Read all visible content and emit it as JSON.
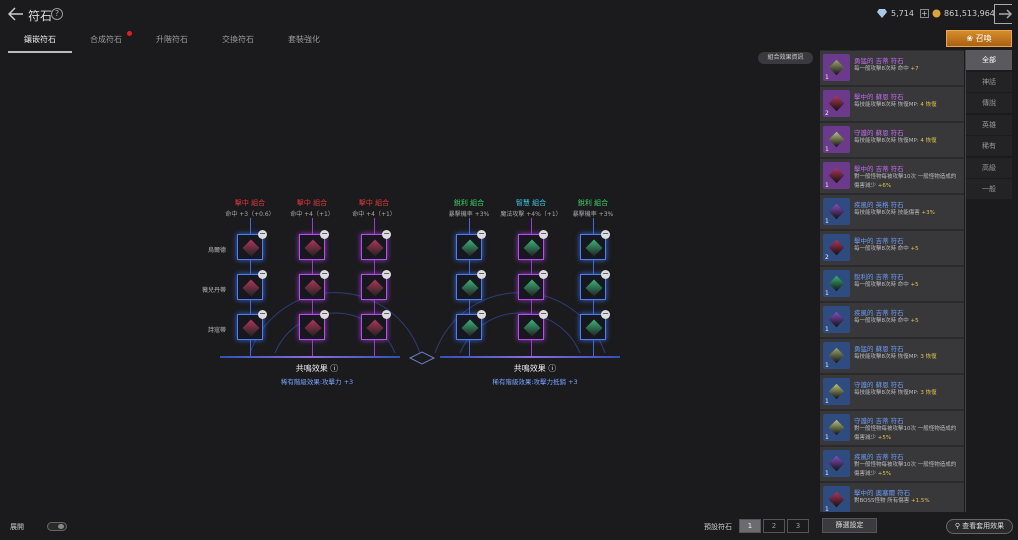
{
  "header": {
    "title": "符石",
    "help": "?",
    "diamonds": "5,714",
    "gold": "861,513,964"
  },
  "tabs": [
    {
      "label": "鑲嵌符石",
      "active": true
    },
    {
      "label": "合成符石",
      "badge": true
    },
    {
      "label": "升階符石"
    },
    {
      "label": "交換符石"
    },
    {
      "label": "套裝強化"
    }
  ],
  "summon_label": "召喚",
  "combo_info_label": "組合效果資訊",
  "board": {
    "row_labels": [
      "烏爾德",
      "薇兒丹蒂",
      "詩寇蒂"
    ],
    "left_combos": [
      {
        "name": "擊中 組合",
        "effect": "命中 +3（+0.6）",
        "color": "#e03a3a"
      },
      {
        "name": "擊中 組合",
        "effect": "命中 +4（+1）",
        "color": "#e03a3a"
      },
      {
        "name": "擊中 組合",
        "effect": "命中 +4（+1）",
        "color": "#e03a3a"
      }
    ],
    "right_combos": [
      {
        "name": "銳利 組合",
        "effect": "暴擊機率 +3%",
        "color": "#3ed46a"
      },
      {
        "name": "智慧 組合",
        "effect": "魔法攻擊 +4%（+1）",
        "color": "#3ec9e8"
      },
      {
        "name": "銳利 組合",
        "effect": "暴擊機率 +3%",
        "color": "#3ed46a"
      }
    ],
    "left_resonance": {
      "title": "共鳴效果 ⓘ",
      "effect": "稀有階級效果:攻擊力 +3"
    },
    "right_resonance": {
      "title": "共鳴效果 ⓘ",
      "effect": "稀有階級效果:攻擊力抵銷 +3"
    }
  },
  "rune_list": [
    {
      "name": "勇猛的 吉蒂 符石",
      "desc": "每一般攻擊8次時 命中",
      "bonus": "+7",
      "count": "1",
      "bg": "#6c3a8c",
      "gem": "#9fa86c"
    },
    {
      "name": "擊中的 蘇恩 符石",
      "desc": "每技能攻擊8次時 恢復MP:",
      "bonus": "4 恢復",
      "count": "2",
      "bg": "#6c3a8c",
      "gem": "#b0365a"
    },
    {
      "name": "守護的 蘇恩 符石",
      "desc": "每技能攻擊8次時 恢復MP:",
      "bonus": "4 恢復",
      "count": "1",
      "bg": "#6c3a8c",
      "gem": "#b9c57a"
    },
    {
      "name": "擊中的 吉蒂 符石",
      "desc": "對一般怪物每被攻擊10次 一般怪物造成的傷害減少",
      "bonus": "+6%",
      "count": "1",
      "bg": "#6c3a8c",
      "gem": "#b0365a"
    },
    {
      "name": "疾風的 英格 符石",
      "desc": "每技能攻擊8次時 技能傷害",
      "bonus": "+3%",
      "count": "1",
      "bg": "#2f4c80",
      "gem": "#8b4cc4"
    },
    {
      "name": "擊中的 吉蒂 符石",
      "desc": "每一般攻擊8次時 命中",
      "bonus": "+5",
      "count": "2",
      "bg": "#2f4c80",
      "gem": "#b0365a"
    },
    {
      "name": "銳利的 吉蒂 符石",
      "desc": "每一般攻擊8次時 命中",
      "bonus": "+5",
      "count": "1",
      "bg": "#2f4c80",
      "gem": "#3bb37a"
    },
    {
      "name": "疾風的 吉蒂 符石",
      "desc": "每一般攻擊8次時 命中",
      "bonus": "+5",
      "count": "1",
      "bg": "#2f4c80",
      "gem": "#8b4cc4"
    },
    {
      "name": "勇猛的 蘇恩 符石",
      "desc": "每技能攻擊8次時 恢復MP:",
      "bonus": "3 恢復",
      "count": "1",
      "bg": "#2f4c80",
      "gem": "#9fa86c"
    },
    {
      "name": "守護的 蘇恩 符石",
      "desc": "每技能攻擊8次時 恢復MP:",
      "bonus": "3 恢復",
      "count": "1",
      "bg": "#2f4c80",
      "gem": "#b9c57a"
    },
    {
      "name": "守護的 吉蒂 符石",
      "desc": "對一般怪物每被攻擊10次 一般怪物造成的傷害減少",
      "bonus": "+5%",
      "count": "1",
      "bg": "#2f4c80",
      "gem": "#b9c57a"
    },
    {
      "name": "疾風的 吉蒂 符石",
      "desc": "對一般怪物每被攻擊10次 一般怪物造成的傷害減少",
      "bonus": "+5%",
      "count": "1",
      "bg": "#2f4c80",
      "gem": "#8b4cc4"
    },
    {
      "name": "擊中的 奧塞爾 符石",
      "desc": "對BOSS怪物 所有傷害",
      "bonus": "+1.5%",
      "count": "1",
      "bg": "#2f4c80",
      "gem": "#b0365a"
    }
  ],
  "categories": [
    {
      "label": "全部",
      "active": true
    },
    {
      "label": "神話"
    },
    {
      "label": "傳說"
    },
    {
      "label": "英雄"
    },
    {
      "label": "稀有"
    },
    {
      "label": "高級"
    },
    {
      "label": "一般"
    }
  ],
  "bottom": {
    "expand_label": "展開",
    "preset_label": "預設符石",
    "presets": [
      "1",
      "2",
      "3"
    ],
    "active_preset": "1",
    "filter_label": "篩選設定",
    "view_label": "查看套用效果"
  }
}
